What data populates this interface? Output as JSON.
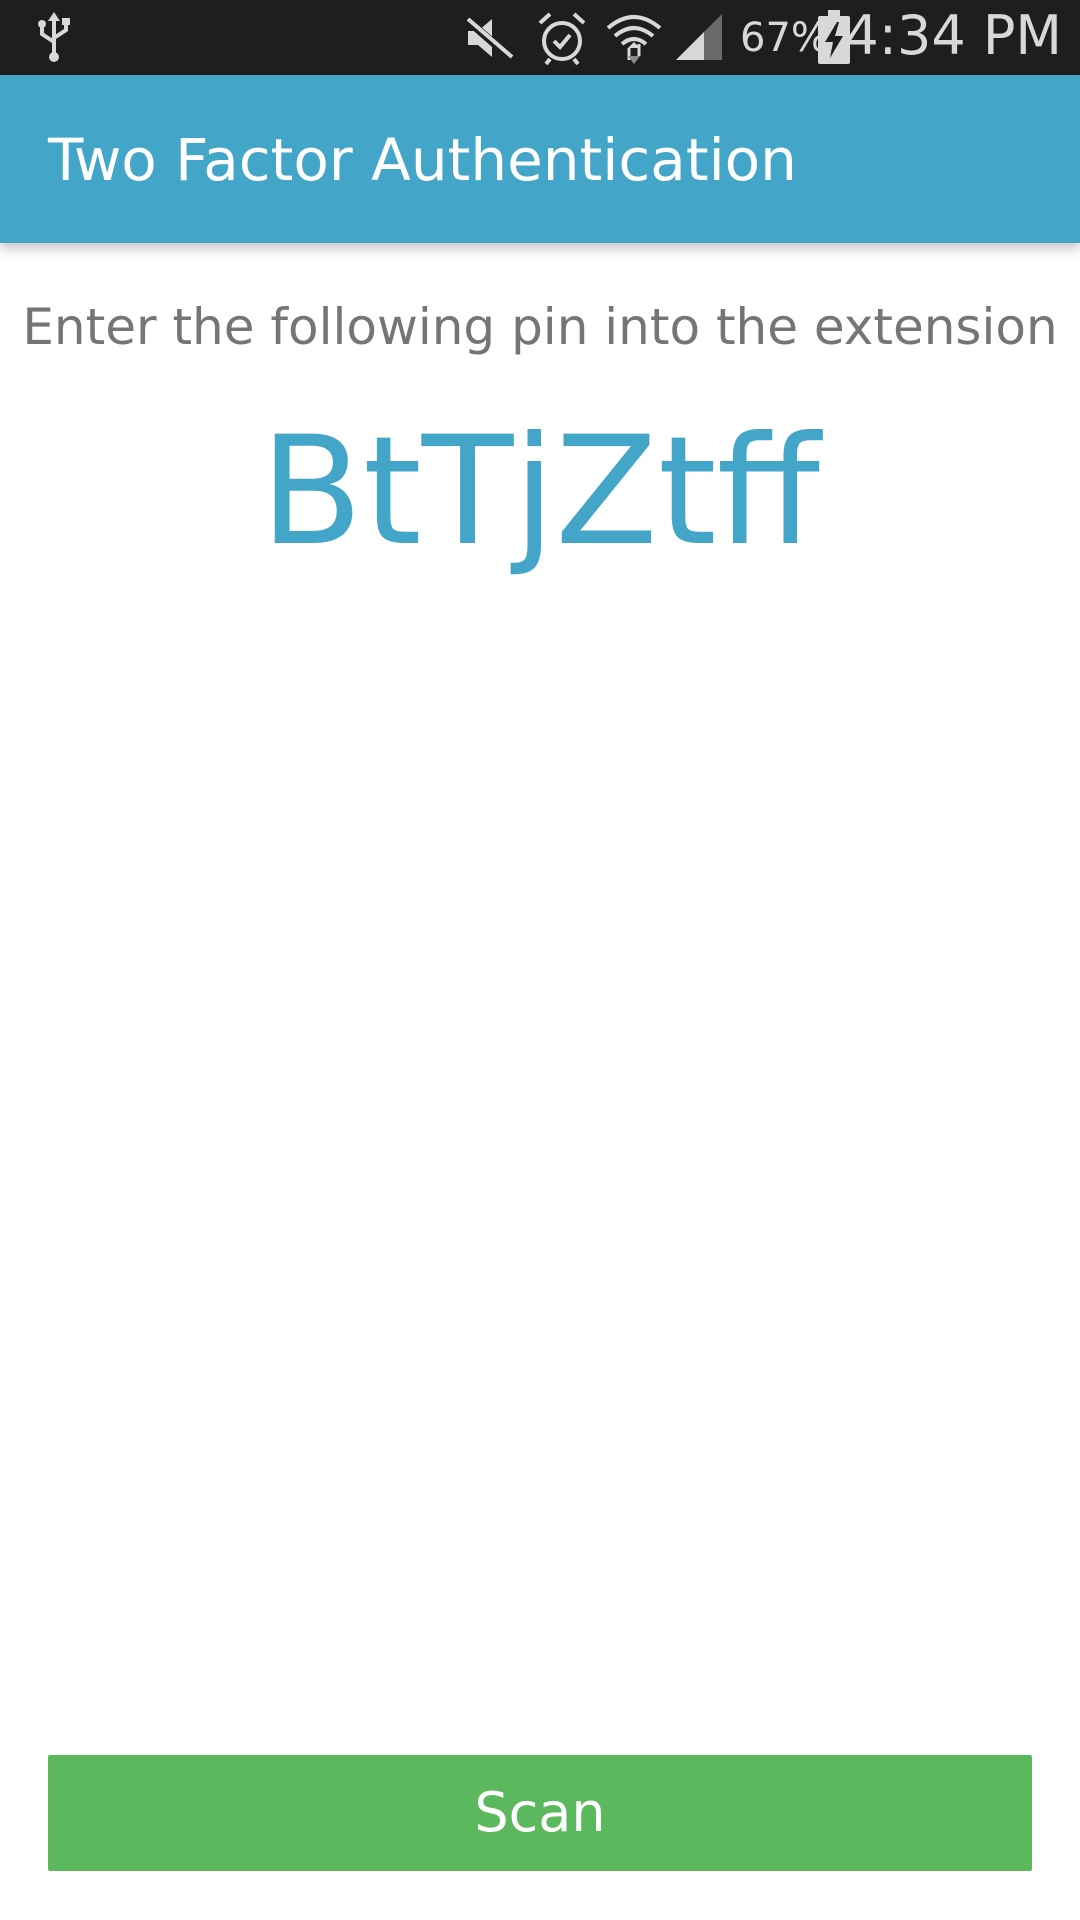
{
  "status_bar": {
    "battery_percent": "67%",
    "time": "4:34 PM",
    "icons": [
      "usb-icon",
      "vibrate-mute-icon",
      "alarm-icon",
      "wifi-icon",
      "cell-signal-icon",
      "battery-charging-icon"
    ]
  },
  "app_bar": {
    "title": "Two Factor Authentication",
    "color": "#43a6c8"
  },
  "main": {
    "instruction": "Enter the following pin into the extension",
    "pin": "BtTjZtff",
    "pin_color": "#43a6c8"
  },
  "scan_button": {
    "label": "Scan",
    "color": "#5cb85c"
  }
}
